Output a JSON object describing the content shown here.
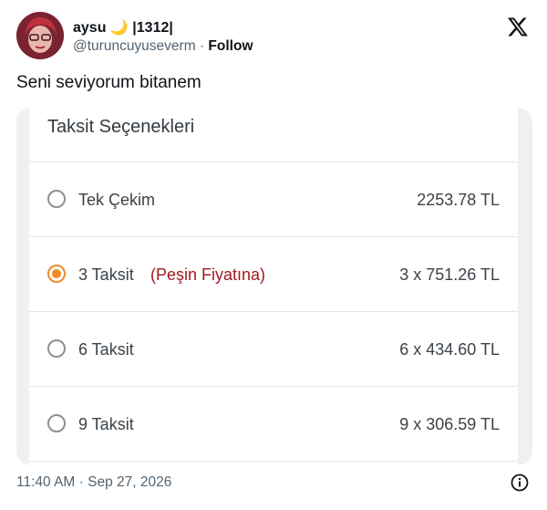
{
  "header": {
    "display_name": "aysu",
    "name_emoji": "🌙",
    "name_suffix": "|1312|",
    "handle": "@turuncuyuseverm",
    "separator": "·",
    "follow_label": "Follow",
    "logo_icon": "x-logo-icon"
  },
  "tweet": {
    "text": "Seni seviyorum bitanem"
  },
  "media": {
    "title": "Taksit Seçenekleri",
    "accent_color": "#f08a24",
    "note_color": "#a1191f",
    "options": [
      {
        "label": "Tek Çekim",
        "note": "",
        "price": "2253.78 TL",
        "selected": false
      },
      {
        "label": "3 Taksit",
        "note": "(Peşin Fiyatına)",
        "price": "3 x 751.26 TL",
        "selected": true
      },
      {
        "label": "6 Taksit",
        "note": "",
        "price": "6 x 434.60 TL",
        "selected": false
      },
      {
        "label": "9 Taksit",
        "note": "",
        "price": "9 x 306.59 TL",
        "selected": false
      }
    ]
  },
  "footer": {
    "timestamp": "11:40 AM · Sep 27, 2026",
    "info_icon": "info-icon"
  }
}
